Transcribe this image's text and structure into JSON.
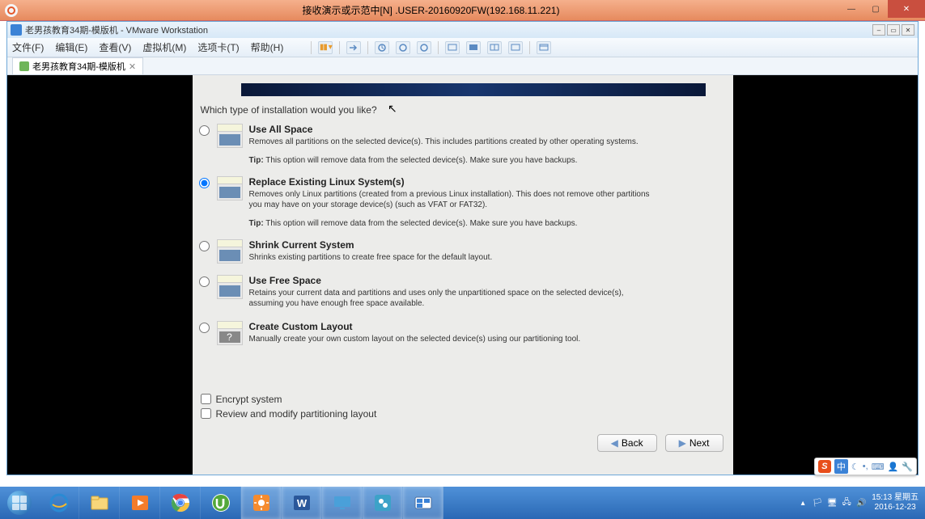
{
  "outer": {
    "title": "接收演示或示范中[N] .USER-20160920FW(192.168.11.221)"
  },
  "vmware": {
    "title": "老男孩教育34期-模版机 - VMware Workstation",
    "menu": {
      "file": "文件(F)",
      "edit": "编辑(E)",
      "view": "查看(V)",
      "vm": "虚拟机(M)",
      "tabs": "选项卡(T)",
      "help": "帮助(H)"
    },
    "tab": {
      "name": "老男孩教育34期-模版机"
    }
  },
  "installer": {
    "question": "Which type of installation would you like?",
    "options": [
      {
        "title": "Use All Space",
        "desc": "Removes all partitions on the selected device(s).  This includes partitions created by other operating systems.",
        "tip_label": "Tip:",
        "tip": " This option will remove data from the selected device(s).  Make sure you have backups."
      },
      {
        "title": "Replace Existing Linux System(s)",
        "desc": "Removes only Linux partitions (created from a previous Linux installation).  This does not remove other partitions you may have on your storage device(s) (such as VFAT or FAT32).",
        "tip_label": "Tip:",
        "tip": " This option will remove data from the selected device(s).  Make sure you have backups."
      },
      {
        "title": "Shrink Current System",
        "desc": "Shrinks existing partitions to create free space for the default layout."
      },
      {
        "title": "Use Free Space",
        "desc": "Retains your current data and partitions and uses only the unpartitioned space on the selected device(s), assuming you have enough free space available."
      },
      {
        "title": "Create Custom Layout",
        "desc": "Manually create your own custom layout on the selected device(s) using our partitioning tool."
      }
    ],
    "encrypt": "Encrypt system",
    "review": "Review and modify partitioning layout",
    "back": "Back",
    "next": "Next"
  },
  "ime": {
    "zh": "中"
  },
  "tray": {
    "time": "15:13",
    "weekday": "星期五",
    "date": "2016-12-23"
  }
}
